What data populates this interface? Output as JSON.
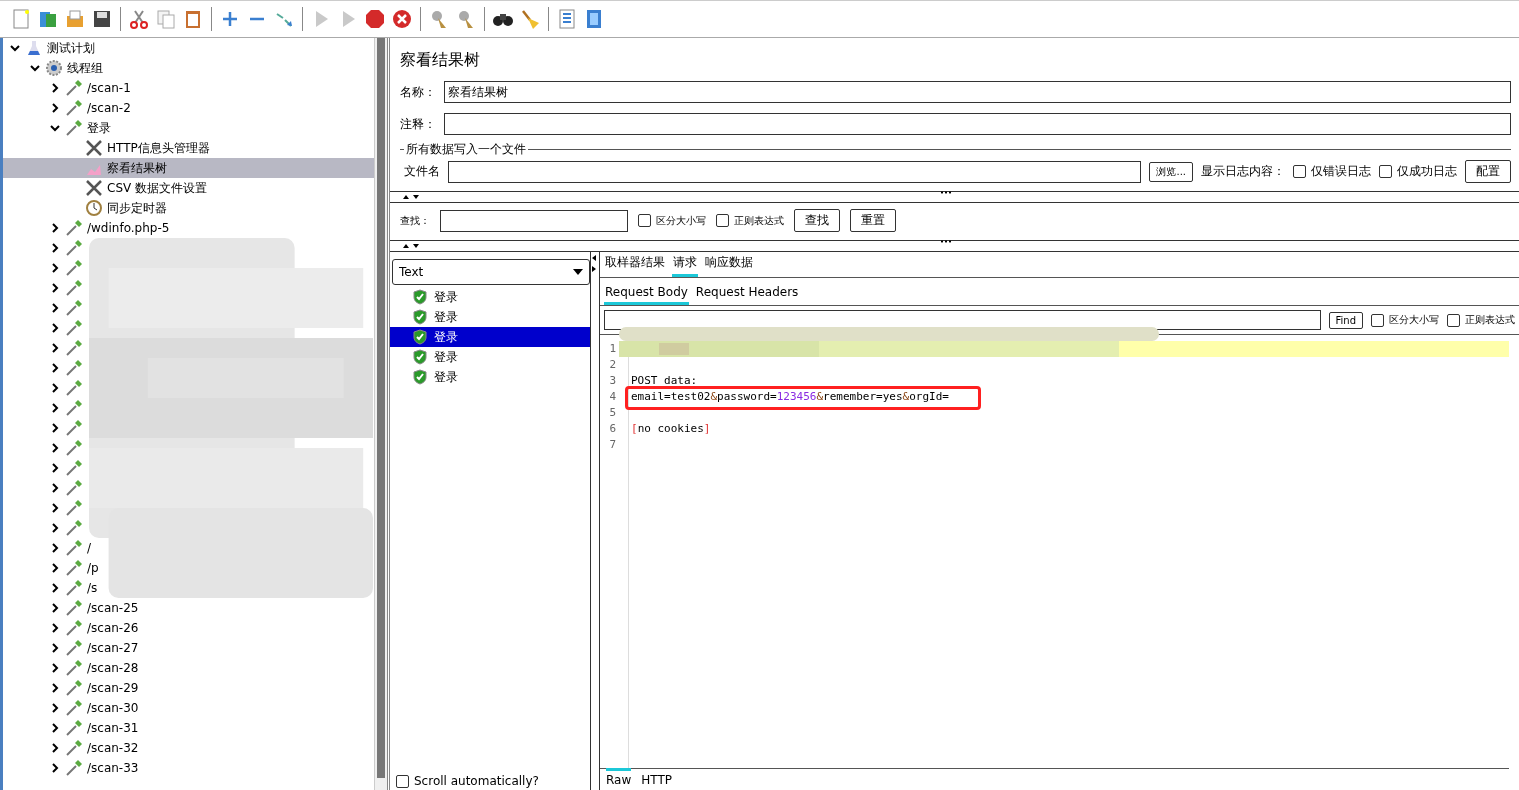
{
  "toolbar": [
    {
      "kind": "new",
      "disabled": false
    },
    {
      "kind": "templates",
      "disabled": false
    },
    {
      "kind": "open",
      "disabled": false
    },
    {
      "kind": "save",
      "disabled": false
    },
    {
      "kind": "sep"
    },
    {
      "kind": "cut",
      "disabled": false
    },
    {
      "kind": "copy",
      "disabled": false
    },
    {
      "kind": "paste",
      "disabled": false
    },
    {
      "kind": "sep"
    },
    {
      "kind": "expand",
      "disabled": false
    },
    {
      "kind": "collapse",
      "disabled": false
    },
    {
      "kind": "toggle",
      "disabled": false
    },
    {
      "kind": "sep"
    },
    {
      "kind": "start",
      "disabled": true
    },
    {
      "kind": "start",
      "disabled": true
    },
    {
      "kind": "stop",
      "disabled": false
    },
    {
      "kind": "shutdown",
      "disabled": false
    },
    {
      "kind": "sep"
    },
    {
      "kind": "clear",
      "disabled": false
    },
    {
      "kind": "clear",
      "disabled": false
    },
    {
      "kind": "sep"
    },
    {
      "kind": "search",
      "disabled": false
    },
    {
      "kind": "broom",
      "disabled": false
    },
    {
      "kind": "sep"
    },
    {
      "kind": "list",
      "disabled": false
    },
    {
      "kind": "help",
      "disabled": false
    }
  ],
  "tree": [
    {
      "label": "测试计划",
      "kind": "plan",
      "expanded": true,
      "selected": false,
      "children": [
        {
          "label": "线程组",
          "kind": "gear",
          "expanded": true,
          "selected": false,
          "children": [
            {
              "label": "/scan-1",
              "kind": "sampler",
              "expanded": false,
              "selected": false
            },
            {
              "label": "/scan-2",
              "kind": "sampler",
              "expanded": false,
              "selected": false
            },
            {
              "label": "登录",
              "kind": "sampler",
              "expanded": true,
              "selected": false,
              "children": [
                {
                  "label": "HTTP信息头管理器",
                  "kind": "tools",
                  "selected": false
                },
                {
                  "label": "察看结果树",
                  "kind": "chart",
                  "selected": true
                },
                {
                  "label": "CSV 数据文件设置",
                  "kind": "tools",
                  "selected": false
                },
                {
                  "label": "同步定时器",
                  "kind": "timer",
                  "selected": false
                }
              ]
            },
            {
              "label": "/wdinfo.php-5",
              "kind": "sampler",
              "expanded": false,
              "selected": false
            },
            {
              "kind": "sampler",
              "expanded": false,
              "selected": false
            },
            {
              "kind": "sampler",
              "expanded": false,
              "selected": false
            },
            {
              "kind": "sampler",
              "expanded": false,
              "selected": false
            },
            {
              "kind": "sampler",
              "expanded": false,
              "selected": false
            },
            {
              "kind": "sampler",
              "expanded": false,
              "selected": false
            },
            {
              "kind": "sampler",
              "expanded": false,
              "selected": false
            },
            {
              "kind": "sampler",
              "expanded": false,
              "selected": false
            },
            {
              "kind": "sampler",
              "expanded": false,
              "selected": false
            },
            {
              "kind": "sampler",
              "expanded": false,
              "selected": false
            },
            {
              "kind": "sampler",
              "expanded": false,
              "selected": false
            },
            {
              "kind": "sampler",
              "expanded": false,
              "selected": false
            },
            {
              "kind": "sampler",
              "expanded": false,
              "selected": false
            },
            {
              "kind": "sampler",
              "expanded": false,
              "selected": false
            },
            {
              "kind": "sampler",
              "expanded": false,
              "selected": false
            },
            {
              "kind": "sampler",
              "expanded": false,
              "selected": false
            },
            {
              "label": "/",
              "kind": "sampler",
              "expanded": false,
              "selected": false
            },
            {
              "label": "/p",
              "kind": "sampler",
              "expanded": false,
              "selected": false
            },
            {
              "label": "/s",
              "kind": "sampler",
              "expanded": false,
              "selected": false
            },
            {
              "label": "/scan-25",
              "kind": "sampler",
              "expanded": false,
              "selected": false
            },
            {
              "label": "/scan-26",
              "kind": "sampler",
              "expanded": false,
              "selected": false
            },
            {
              "label": "/scan-27",
              "kind": "sampler",
              "expanded": false,
              "selected": false
            },
            {
              "label": "/scan-28",
              "kind": "sampler",
              "expanded": false,
              "selected": false
            },
            {
              "label": "/scan-29",
              "kind": "sampler",
              "expanded": false,
              "selected": false
            },
            {
              "label": "/scan-30",
              "kind": "sampler",
              "expanded": false,
              "selected": false
            },
            {
              "label": "/scan-31",
              "kind": "sampler",
              "expanded": false,
              "selected": false
            },
            {
              "label": "/scan-32",
              "kind": "sampler",
              "expanded": false,
              "selected": false
            },
            {
              "label": "/scan-33",
              "kind": "sampler",
              "expanded": false,
              "selected": false
            }
          ]
        }
      ]
    }
  ],
  "panel": {
    "title": "察看结果树",
    "name_label": "名称：",
    "name_value": "察看结果树",
    "comment_label": "注释：",
    "file_group": "所有数据写入一个文件",
    "file_label": "文件名",
    "browse": "浏览...",
    "log_label": "显示日志内容：",
    "log_options": [
      {
        "label": "仅错误日志",
        "checked": false
      },
      {
        "label": "仅成功日志",
        "checked": false
      }
    ],
    "configure": "配置"
  },
  "search": {
    "label": "查找：",
    "options": [
      {
        "label": "区分大小写",
        "checked": false
      },
      {
        "label": "正则表达式",
        "checked": false
      }
    ],
    "find": "查找",
    "reset": "重置"
  },
  "results": {
    "renderer": "Text",
    "samples": [
      {
        "label": "登录",
        "success": true,
        "selected": false
      },
      {
        "label": "登录",
        "success": true,
        "selected": false
      },
      {
        "label": "登录",
        "success": true,
        "selected": true
      },
      {
        "label": "登录",
        "success": true,
        "selected": false
      },
      {
        "label": "登录",
        "success": true,
        "selected": false
      }
    ],
    "scroll": {
      "label": "Scroll automatically?",
      "checked": false
    }
  },
  "detail": {
    "tabs": [
      {
        "label": "取样器结果",
        "selected": false
      },
      {
        "label": "请求",
        "selected": true
      },
      {
        "label": "响应数据",
        "selected": false
      }
    ],
    "subtabs": [
      {
        "label": "Request Body",
        "selected": true
      },
      {
        "label": "Request Headers",
        "selected": false
      }
    ],
    "find_button": "Find",
    "find_options": [
      {
        "label": "区分大小写",
        "checked": false
      },
      {
        "label": "正则表达式",
        "checked": false
      }
    ],
    "lines": [
      {
        "number": "1",
        "highlight": true,
        "kind": "blurred"
      },
      {
        "number": "2",
        "highlight": false
      },
      {
        "number": "3",
        "highlight": false,
        "tokens": [
          {
            "text": "POST data:",
            "kind": "plain"
          }
        ]
      },
      {
        "number": "4",
        "highlight": false,
        "annotated": true,
        "tokens": [
          {
            "text": "email=test02",
            "kind": "plain"
          },
          {
            "text": "&",
            "kind": "amp"
          },
          {
            "text": "password=",
            "kind": "plain"
          },
          {
            "text": "123456",
            "kind": "number"
          },
          {
            "text": "&",
            "kind": "amp"
          },
          {
            "text": "remember=yes",
            "kind": "plain"
          },
          {
            "text": "&",
            "kind": "amp"
          },
          {
            "text": "orgId=",
            "kind": "plain"
          }
        ]
      },
      {
        "number": "5",
        "highlight": false
      },
      {
        "number": "6",
        "highlight": false,
        "tokens": [
          {
            "text": "[",
            "kind": "bracket"
          },
          {
            "text": "no cookies",
            "kind": "plain"
          },
          {
            "text": "]",
            "kind": "bracket"
          }
        ]
      },
      {
        "number": "7",
        "highlight": false
      }
    ],
    "bottom_tabs": [
      {
        "label": "Raw",
        "selected": true
      },
      {
        "label": "HTTP",
        "selected": false
      }
    ]
  }
}
